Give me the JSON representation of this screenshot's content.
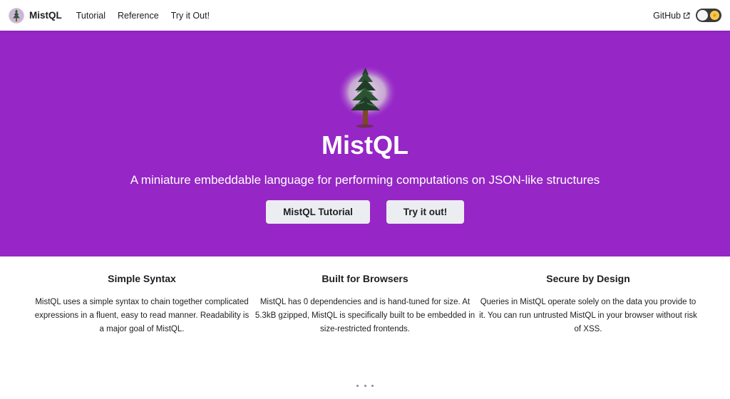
{
  "nav": {
    "brand": "MistQL",
    "links": [
      "Tutorial",
      "Reference",
      "Try it Out!"
    ],
    "github": "GitHub"
  },
  "hero": {
    "title": "MistQL",
    "subtitle": "A miniature embeddable language for performing computations on JSON-like structures",
    "buttons": [
      "MistQL Tutorial",
      "Try it out!"
    ]
  },
  "features": [
    {
      "title": "Simple Syntax",
      "body": "MistQL uses a simple syntax to chain together complicated expressions in a fluent, easy to read manner. Readability is a major goal of MistQL."
    },
    {
      "title": "Built for Browsers",
      "body": "MistQL has 0 dependencies and is hand-tuned for size. At 5.3kB gzipped, MistQL is specifically built to be embedded in size-restricted frontends."
    },
    {
      "title": "Secure by Design",
      "body": "Queries in MistQL operate solely on the data you provide to it. You can run untrusted MistQL in your browser without risk of XSS."
    }
  ],
  "icons": {
    "logo": "tree-logo-icon",
    "external": "external-link-icon",
    "theme_toggle": "sun-icon"
  },
  "colors": {
    "hero_background": "#9626c6",
    "button_background": "#ebedf0",
    "toggle_background": "#3a3a3a"
  }
}
